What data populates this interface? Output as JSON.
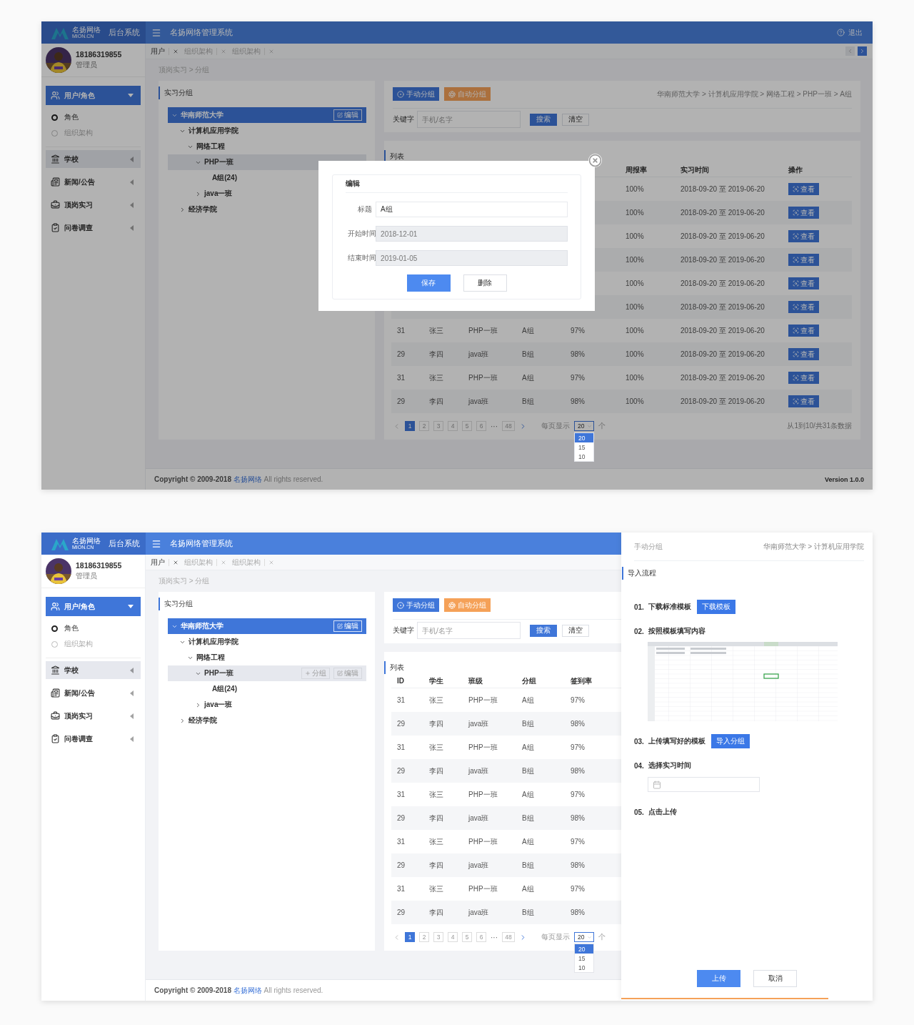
{
  "screens": [
    {
      "header": {
        "logo_name": "名扬网络",
        "logo_domain": "MION.CN",
        "area": "后台系统",
        "title": "名扬网络管理系统",
        "exit": "退出"
      },
      "user": {
        "phone": "18186319855",
        "role": "管理员"
      },
      "menu": [
        {
          "label": "用户/角色",
          "selected": true,
          "expanded": true,
          "children": [
            {
              "label": "角色",
              "selected": true
            },
            {
              "label": "组织架构",
              "selected": false
            }
          ]
        },
        {
          "label": "学校",
          "selected": false,
          "expanded": false,
          "highlighted": true
        },
        {
          "label": "新闻/公告",
          "selected": false,
          "expanded": false,
          "highlighted": false
        },
        {
          "label": "顶岗实习",
          "selected": false,
          "expanded": false,
          "highlighted": false
        },
        {
          "label": "问卷调查",
          "selected": false,
          "expanded": false,
          "highlighted": false
        }
      ],
      "tabs": [
        {
          "label": "用户",
          "selected": true
        },
        {
          "label": "组织架构",
          "selected": false
        },
        {
          "label": "组织架构",
          "selected": false
        }
      ],
      "tab_nav": true,
      "breadcrumb": "顶岗实习 > 分组",
      "tree": {
        "title": "实习分组",
        "nodes": [
          {
            "label": "华南师范大学",
            "expanded": true,
            "selected": true,
            "actions": [
              {
                "kind": "edit",
                "label": "编辑"
              }
            ],
            "children": [
              {
                "label": "计算机应用学院",
                "expanded": true,
                "selected": false,
                "highlighted": false,
                "children": [
                  {
                    "label": "网络工程",
                    "expanded": true,
                    "selected": false,
                    "highlighted": false,
                    "children": [
                      {
                        "label": "PHP一班",
                        "expanded": true,
                        "selected": false,
                        "highlighted": true,
                        "children": [
                          {
                            "label": "A组(24)",
                            "selected": false,
                            "highlighted": false
                          }
                        ]
                      },
                      {
                        "label": "java一班",
                        "expanded": false,
                        "selected": false,
                        "highlighted": false
                      }
                    ]
                  }
                ]
              },
              {
                "label": "经济学院",
                "expanded": false,
                "selected": false,
                "highlighted": false
              }
            ]
          }
        ]
      },
      "toolbar": {
        "buttons": [
          {
            "kind": "manual",
            "label": "手动分组"
          },
          {
            "kind": "auto",
            "label": "自动分组"
          }
        ],
        "path": "华南师范大学 > 计算机应用学院 > 网络工程 > PHP一班 > A组"
      },
      "search": {
        "label": "关键字",
        "placeholder": "手机/名字",
        "buttons": [
          {
            "kind": "primary",
            "label": "搜索"
          },
          {
            "kind": "plain",
            "label": "清空"
          }
        ]
      },
      "list": {
        "title": "列表",
        "columns": [
          null,
          null,
          null,
          null,
          null,
          "周报率",
          "实习时间",
          "操作"
        ],
        "rows": [
          {
            "cells": [
              null,
              null,
              null,
              null,
              null,
              "100%",
              "2018-09-20 至 2019-06-20"
            ],
            "action": "查看"
          },
          {
            "cells": [
              null,
              null,
              null,
              null,
              null,
              "100%",
              "2018-09-20 至 2019-06-20"
            ],
            "action": "查看"
          },
          {
            "cells": [
              null,
              null,
              null,
              null,
              null,
              "100%",
              "2018-09-20 至 2019-06-20"
            ],
            "action": "查看"
          },
          {
            "cells": [
              null,
              null,
              null,
              null,
              null,
              "100%",
              "2018-09-20 至 2019-06-20"
            ],
            "action": "查看"
          },
          {
            "cells": [
              null,
              null,
              null,
              null,
              null,
              "100%",
              "2018-09-20 至 2019-06-20"
            ],
            "action": "查看"
          },
          {
            "cells": [
              null,
              null,
              null,
              null,
              null,
              "100%",
              "2018-09-20 至 2019-06-20"
            ],
            "action": "查看"
          },
          {
            "cells": [
              "31",
              "张三",
              "PHP一班",
              "A组",
              "97%",
              "100%",
              "2018-09-20 至 2019-06-20"
            ],
            "action": "查看"
          },
          {
            "cells": [
              "29",
              "李四",
              "java班",
              "B组",
              "98%",
              "100%",
              "2018-09-20 至 2019-06-20"
            ],
            "action": "查看"
          },
          {
            "cells": [
              "31",
              "张三",
              "PHP一班",
              "A组",
              "97%",
              "100%",
              "2018-09-20 至 2019-06-20"
            ],
            "action": "查看"
          },
          {
            "cells": [
              "29",
              "李四",
              "java班",
              "B组",
              "98%",
              "100%",
              "2018-09-20 至 2019-06-20"
            ],
            "action": "查看"
          }
        ]
      },
      "pagination": {
        "pages": [
          {
            "label": "1",
            "selected": true
          },
          {
            "label": "2",
            "selected": false
          },
          {
            "label": "3",
            "selected": false
          },
          {
            "label": "4",
            "selected": false
          },
          {
            "label": "5",
            "selected": false
          },
          {
            "label": "6",
            "selected": false
          }
        ],
        "ellipsis": "···",
        "last": "48",
        "per_page_label": "每页显示",
        "per_page": "20",
        "unit": "个",
        "options": [
          {
            "label": "20",
            "selected": true
          },
          {
            "label": "15",
            "selected": false
          },
          {
            "label": "10",
            "selected": false
          }
        ],
        "summary": "从1到10/共31条数据"
      },
      "footer": {
        "before": "Copyright © 2009-2018 ",
        "company": "名扬网络",
        "after": " All rights reserved.",
        "version": "Version 1.0.0"
      },
      "modal": {
        "title": "编辑",
        "fields": [
          {
            "label": "标题",
            "value": "A组",
            "readonly": false
          },
          {
            "label": "开始时间",
            "value": "2018-12-01",
            "readonly": true
          },
          {
            "label": "结束时间",
            "value": "2019-01-05",
            "readonly": true
          }
        ],
        "buttons": [
          {
            "kind": "primary",
            "label": "保存"
          },
          {
            "kind": "plain",
            "label": "删除"
          }
        ]
      }
    },
    {
      "header": {
        "logo_name": "名扬网络",
        "logo_domain": "MION.CN",
        "area": "后台系统",
        "title": "名扬网络管理系统"
      },
      "user": {
        "phone": "18186319855",
        "role": "管理员"
      },
      "menu": [
        {
          "label": "用户/角色",
          "selected": true,
          "expanded": true,
          "children": [
            {
              "label": "角色",
              "selected": true
            },
            {
              "label": "组织架构",
              "selected": false
            }
          ]
        },
        {
          "label": "学校",
          "selected": false,
          "expanded": false,
          "highlighted": true
        },
        {
          "label": "新闻/公告",
          "selected": false,
          "expanded": false,
          "highlighted": false
        },
        {
          "label": "顶岗实习",
          "selected": false,
          "expanded": false,
          "highlighted": false
        },
        {
          "label": "问卷调查",
          "selected": false,
          "expanded": false,
          "highlighted": false
        }
      ],
      "tabs": [
        {
          "label": "用户",
          "selected": true
        },
        {
          "label": "组织架构",
          "selected": false
        },
        {
          "label": "组织架构",
          "selected": false
        }
      ],
      "breadcrumb": "顶岗实习 > 分组",
      "tree": {
        "title": "实习分组",
        "nodes": [
          {
            "label": "华南师范大学",
            "expanded": true,
            "selected": true,
            "actions": [
              {
                "kind": "edit",
                "label": "编辑"
              }
            ],
            "children": [
              {
                "label": "计算机应用学院",
                "expanded": true,
                "selected": false,
                "highlighted": false,
                "children": [
                  {
                    "label": "网络工程",
                    "expanded": true,
                    "selected": false,
                    "highlighted": false,
                    "children": [
                      {
                        "label": "PHP一班",
                        "expanded": true,
                        "selected": false,
                        "highlighted": true,
                        "actions": [
                          {
                            "kind": "add",
                            "label": "分组"
                          },
                          {
                            "kind": "edit",
                            "label": "编辑"
                          }
                        ],
                        "children": [
                          {
                            "label": "A组(24)",
                            "selected": false,
                            "highlighted": false
                          }
                        ]
                      },
                      {
                        "label": "java一班",
                        "expanded": false,
                        "selected": false,
                        "highlighted": false
                      }
                    ]
                  }
                ]
              },
              {
                "label": "经济学院",
                "expanded": false,
                "selected": false,
                "highlighted": false
              }
            ]
          }
        ]
      },
      "toolbar": {
        "buttons": [
          {
            "kind": "manual",
            "label": "手动分组"
          },
          {
            "kind": "auto",
            "label": "自动分组"
          }
        ]
      },
      "search": {
        "label": "关键字",
        "placeholder": "手机/名字",
        "buttons": [
          {
            "kind": "primary",
            "label": "搜索"
          },
          {
            "kind": "plain",
            "label": "清空"
          }
        ]
      },
      "list": {
        "title": "列表",
        "columns": [
          "ID",
          "学生",
          "班级",
          "分组",
          "签到率"
        ],
        "rows": [
          {
            "cells": [
              "31",
              "张三",
              "PHP一班",
              "A组",
              "97%"
            ]
          },
          {
            "cells": [
              "29",
              "李四",
              "java班",
              "B组",
              "98%"
            ]
          },
          {
            "cells": [
              "31",
              "张三",
              "PHP一班",
              "A组",
              "97%"
            ]
          },
          {
            "cells": [
              "29",
              "李四",
              "java班",
              "B组",
              "98%"
            ]
          },
          {
            "cells": [
              "31",
              "张三",
              "PHP一班",
              "A组",
              "97%"
            ]
          },
          {
            "cells": [
              "29",
              "李四",
              "java班",
              "B组",
              "98%"
            ]
          },
          {
            "cells": [
              "31",
              "张三",
              "PHP一班",
              "A组",
              "97%"
            ]
          },
          {
            "cells": [
              "29",
              "李四",
              "java班",
              "B组",
              "98%"
            ]
          },
          {
            "cells": [
              "31",
              "张三",
              "PHP一班",
              "A组",
              "97%"
            ]
          },
          {
            "cells": [
              "29",
              "李四",
              "java班",
              "B组",
              "98%"
            ]
          }
        ]
      },
      "pagination": {
        "pages": [
          {
            "label": "1",
            "selected": true
          },
          {
            "label": "2",
            "selected": false
          },
          {
            "label": "3",
            "selected": false
          },
          {
            "label": "4",
            "selected": false
          },
          {
            "label": "5",
            "selected": false
          },
          {
            "label": "6",
            "selected": false
          }
        ],
        "ellipsis": "···",
        "last": "48",
        "per_page_label": "每页显示",
        "per_page": "20",
        "unit": "个",
        "options": [
          {
            "label": "20",
            "selected": true
          },
          {
            "label": "15",
            "selected": false
          },
          {
            "label": "10",
            "selected": false
          }
        ]
      },
      "footer": {
        "before": "Copyright © 2009-2018 ",
        "company": "名扬网络",
        "after": " All rights reserved."
      },
      "drawer": {
        "title": "手动分组",
        "path": "华南师范大学 > 计算机应用学院",
        "section": "导入流程",
        "steps": [
          {
            "number": "01.",
            "label": "下载标准模板",
            "kind": "button",
            "button": "下载模板"
          },
          {
            "number": "02.",
            "label": "按照模板填写内容",
            "kind": "picture"
          },
          {
            "number": "03.",
            "label": "上传填写好的模板",
            "kind": "button",
            "button": "导入分组"
          },
          {
            "number": "04.",
            "label": "选择实习时间",
            "kind": "date"
          },
          {
            "number": "05.",
            "label": "点击上传",
            "kind": "text"
          }
        ],
        "buttons": [
          {
            "kind": "primary",
            "label": "上传"
          },
          {
            "kind": "plain",
            "label": "取消"
          }
        ]
      }
    }
  ]
}
